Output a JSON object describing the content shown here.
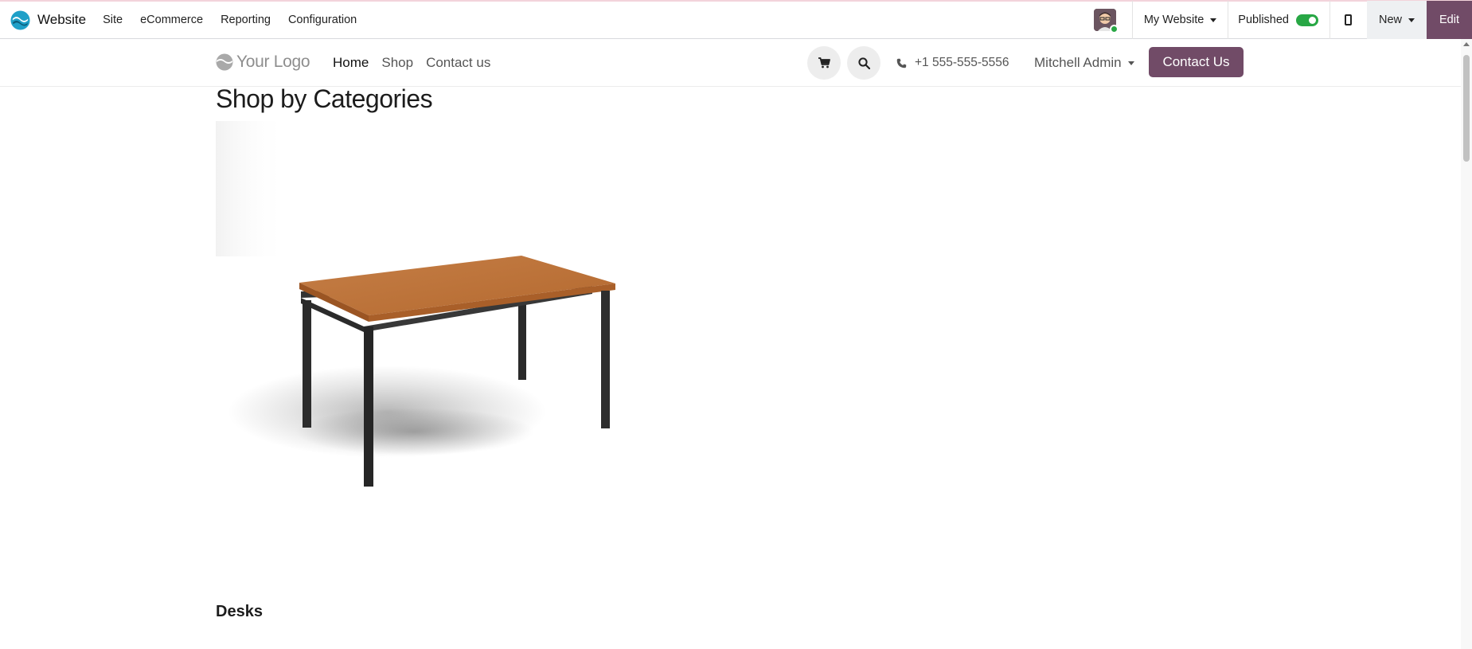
{
  "admin_bar": {
    "app_name": "Website",
    "menu": [
      "Site",
      "eCommerce",
      "Reporting",
      "Configuration"
    ],
    "website_selector": "My Website",
    "published_label": "Published",
    "published": true,
    "new_label": "New",
    "edit_label": "Edit"
  },
  "site_header": {
    "logo_text": "Your Logo",
    "nav": [
      "Home",
      "Shop",
      "Contact us"
    ],
    "active_nav": "Home",
    "phone": "+1 555-555-5556",
    "user_name": "Mitchell Admin",
    "contact_button": "Contact Us"
  },
  "main": {
    "title": "Shop by Categories",
    "categories": [
      {
        "name": "Desks",
        "image_icon": "desk-table-image"
      }
    ]
  },
  "colors": {
    "brand": "#714b67",
    "toggle_on": "#28a745"
  }
}
